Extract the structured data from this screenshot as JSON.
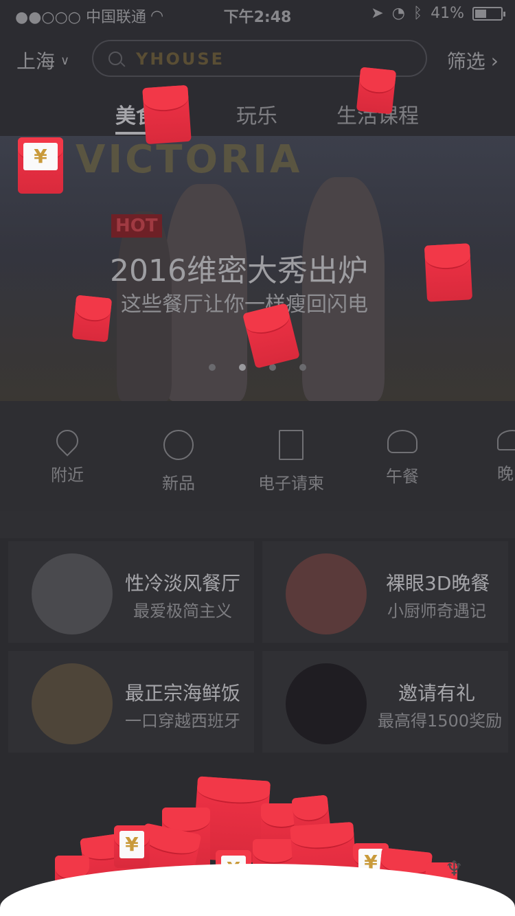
{
  "status": {
    "carrier": "●●○○○ 中国联通",
    "time": "下午2:48",
    "battery": "41%"
  },
  "header": {
    "city": "上海",
    "search_logo": "YHOUSE",
    "filter": "筛选"
  },
  "tabs": [
    "美食",
    "玩乐",
    "生活课程"
  ],
  "banner": {
    "bg_text": "VICTORIA",
    "hot": "HOT",
    "title": "2016维密大秀出炉",
    "subtitle": "这些餐厅让你一样瘦回闪电"
  },
  "quick": [
    "附近",
    "新品",
    "电子请柬",
    "午餐",
    "晚"
  ],
  "cards": [
    {
      "title": "性冷淡风餐厅",
      "sub": "最爱极简主义"
    },
    {
      "title": "裸眼3D晚餐",
      "sub": "小厨师奇遇记"
    },
    {
      "title": "最正宗海鲜饭",
      "sub": "一口穿越西班牙"
    },
    {
      "title": "邀请有礼",
      "sub": "最高得1500奖励"
    }
  ],
  "envelope": {
    "yen": "¥"
  },
  "colors": {
    "envelope_red": "#e92b3d",
    "overlay_dark": "#2c2c31",
    "floor": "#ffffff"
  }
}
